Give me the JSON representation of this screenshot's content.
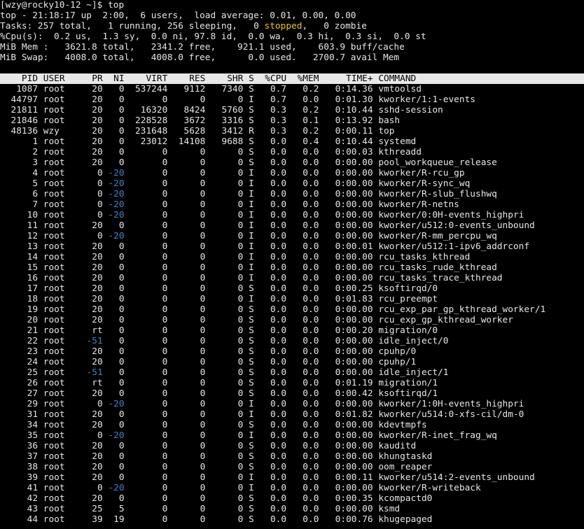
{
  "prompt": "[wzy@rocky10-12 ~]$ top",
  "summary": {
    "line1": "top - 21:18:17 up  2:00,  6 users,  load average: 0.01, 0.00, 0.00",
    "tasks_pre": "Tasks: 257 total,   1 running, 256 sleeping,   0 ",
    "tasks_hl": "stopped",
    "tasks_post": ",   0 zombie",
    "cpu": "%Cpu(s):  0.2 us,  1.3 sy,  0.0 ni, 97.8 id,  0.0 wa,  0.3 hi,  0.3 si,  0.0 st",
    "mem": "MiB Mem :   3621.8 total,   2341.2 free,    921.1 used,    603.9 buff/cache",
    "swap": "MiB Swap:   4008.0 total,   4008.0 free,      0.0 used.   2700.7 avail Mem"
  },
  "columns": [
    "PID",
    "USER",
    "PR",
    "NI",
    "VIRT",
    "RES",
    "SHR",
    "S",
    "%CPU",
    "%MEM",
    "TIME+",
    "COMMAND"
  ],
  "processes": [
    [
      "1087",
      "root",
      "20",
      "0",
      "537244",
      "9112",
      "7340",
      "S",
      "0.7",
      "0.2",
      "0:14.36",
      "vmtoolsd"
    ],
    [
      "44797",
      "root",
      "20",
      "0",
      "0",
      "0",
      "0",
      "I",
      "0.7",
      "0.0",
      "0:01.30",
      "kworker/1:1-events"
    ],
    [
      "21811",
      "root",
      "20",
      "0",
      "16320",
      "8424",
      "5760",
      "S",
      "0.3",
      "0.2",
      "0:10.44",
      "sshd-session"
    ],
    [
      "21846",
      "root",
      "20",
      "0",
      "228528",
      "3672",
      "3316",
      "S",
      "0.3",
      "0.1",
      "0:13.92",
      "bash"
    ],
    [
      "48136",
      "wzy",
      "20",
      "0",
      "231648",
      "5628",
      "3412",
      "R",
      "0.3",
      "0.2",
      "0:00.11",
      "top"
    ],
    [
      "1",
      "root",
      "20",
      "0",
      "23012",
      "14108",
      "9688",
      "S",
      "0.0",
      "0.4",
      "0:10.44",
      "systemd"
    ],
    [
      "2",
      "root",
      "20",
      "0",
      "0",
      "0",
      "0",
      "S",
      "0.0",
      "0.0",
      "0:00.03",
      "kthreadd"
    ],
    [
      "3",
      "root",
      "20",
      "0",
      "0",
      "0",
      "0",
      "S",
      "0.0",
      "0.0",
      "0:00.00",
      "pool_workqueue_release"
    ],
    [
      "4",
      "root",
      "0",
      "-20",
      "0",
      "0",
      "0",
      "I",
      "0.0",
      "0.0",
      "0:00.00",
      "kworker/R-rcu_gp"
    ],
    [
      "5",
      "root",
      "0",
      "-20",
      "0",
      "0",
      "0",
      "I",
      "0.0",
      "0.0",
      "0:00.00",
      "kworker/R-sync_wq"
    ],
    [
      "6",
      "root",
      "0",
      "-20",
      "0",
      "0",
      "0",
      "I",
      "0.0",
      "0.0",
      "0:00.00",
      "kworker/R-slub_flushwq"
    ],
    [
      "7",
      "root",
      "0",
      "-20",
      "0",
      "0",
      "0",
      "I",
      "0.0",
      "0.0",
      "0:00.00",
      "kworker/R-netns"
    ],
    [
      "10",
      "root",
      "0",
      "-20",
      "0",
      "0",
      "0",
      "I",
      "0.0",
      "0.0",
      "0:00.00",
      "kworker/0:0H-events_highpri"
    ],
    [
      "11",
      "root",
      "20",
      "0",
      "0",
      "0",
      "0",
      "I",
      "0.0",
      "0.0",
      "0:00.00",
      "kworker/u512:0-events_unbound"
    ],
    [
      "12",
      "root",
      "0",
      "-20",
      "0",
      "0",
      "0",
      "I",
      "0.0",
      "0.0",
      "0:00.00",
      "kworker/R-mm_percpu_wq"
    ],
    [
      "13",
      "root",
      "20",
      "0",
      "0",
      "0",
      "0",
      "I",
      "0.0",
      "0.0",
      "0:00.01",
      "kworker/u512:1-ipv6_addrconf"
    ],
    [
      "14",
      "root",
      "20",
      "0",
      "0",
      "0",
      "0",
      "I",
      "0.0",
      "0.0",
      "0:00.00",
      "rcu_tasks_kthread"
    ],
    [
      "15",
      "root",
      "20",
      "0",
      "0",
      "0",
      "0",
      "I",
      "0.0",
      "0.0",
      "0:00.00",
      "rcu_tasks_rude_kthread"
    ],
    [
      "16",
      "root",
      "20",
      "0",
      "0",
      "0",
      "0",
      "I",
      "0.0",
      "0.0",
      "0:00.00",
      "rcu_tasks_trace_kthread"
    ],
    [
      "17",
      "root",
      "20",
      "0",
      "0",
      "0",
      "0",
      "S",
      "0.0",
      "0.0",
      "0:00.25",
      "ksoftirqd/0"
    ],
    [
      "18",
      "root",
      "20",
      "0",
      "0",
      "0",
      "0",
      "I",
      "0.0",
      "0.0",
      "0:01.83",
      "rcu_preempt"
    ],
    [
      "19",
      "root",
      "20",
      "0",
      "0",
      "0",
      "0",
      "S",
      "0.0",
      "0.0",
      "0:00.00",
      "rcu_exp_par_gp_kthread_worker/1"
    ],
    [
      "20",
      "root",
      "20",
      "0",
      "0",
      "0",
      "0",
      "S",
      "0.0",
      "0.0",
      "0:00.00",
      "rcu_exp_gp_kthread_worker"
    ],
    [
      "21",
      "root",
      "rt",
      "0",
      "0",
      "0",
      "0",
      "S",
      "0.0",
      "0.0",
      "0:00.20",
      "migration/0"
    ],
    [
      "22",
      "root",
      "-51",
      "0",
      "0",
      "0",
      "0",
      "S",
      "0.0",
      "0.0",
      "0:00.00",
      "idle_inject/0"
    ],
    [
      "23",
      "root",
      "20",
      "0",
      "0",
      "0",
      "0",
      "S",
      "0.0",
      "0.0",
      "0:00.00",
      "cpuhp/0"
    ],
    [
      "24",
      "root",
      "20",
      "0",
      "0",
      "0",
      "0",
      "S",
      "0.0",
      "0.0",
      "0:00.00",
      "cpuhp/1"
    ],
    [
      "25",
      "root",
      "-51",
      "0",
      "0",
      "0",
      "0",
      "S",
      "0.0",
      "0.0",
      "0:00.00",
      "idle_inject/1"
    ],
    [
      "26",
      "root",
      "rt",
      "0",
      "0",
      "0",
      "0",
      "S",
      "0.0",
      "0.0",
      "0:01.19",
      "migration/1"
    ],
    [
      "27",
      "root",
      "20",
      "0",
      "0",
      "0",
      "0",
      "S",
      "0.0",
      "0.0",
      "0:00.42",
      "ksoftirqd/1"
    ],
    [
      "29",
      "root",
      "0",
      "-20",
      "0",
      "0",
      "0",
      "I",
      "0.0",
      "0.0",
      "0:00.00",
      "kworker/1:0H-events_highpri"
    ],
    [
      "31",
      "root",
      "20",
      "0",
      "0",
      "0",
      "0",
      "I",
      "0.0",
      "0.0",
      "0:01.82",
      "kworker/u514:0-xfs-cil/dm-0"
    ],
    [
      "34",
      "root",
      "20",
      "0",
      "0",
      "0",
      "0",
      "S",
      "0.0",
      "0.0",
      "0:00.00",
      "kdevtmpfs"
    ],
    [
      "35",
      "root",
      "0",
      "-20",
      "0",
      "0",
      "0",
      "I",
      "0.0",
      "0.0",
      "0:00.00",
      "kworker/R-inet_frag_wq"
    ],
    [
      "36",
      "root",
      "20",
      "0",
      "0",
      "0",
      "0",
      "S",
      "0.0",
      "0.0",
      "0:00.00",
      "kauditd"
    ],
    [
      "37",
      "root",
      "20",
      "0",
      "0",
      "0",
      "0",
      "S",
      "0.0",
      "0.0",
      "0:00.00",
      "khungtaskd"
    ],
    [
      "38",
      "root",
      "20",
      "0",
      "0",
      "0",
      "0",
      "S",
      "0.0",
      "0.0",
      "0:00.00",
      "oom_reaper"
    ],
    [
      "39",
      "root",
      "20",
      "0",
      "0",
      "0",
      "0",
      "I",
      "0.0",
      "0.0",
      "0:00.11",
      "kworker/u514:2-events_unbound"
    ],
    [
      "41",
      "root",
      "0",
      "-20",
      "0",
      "0",
      "0",
      "I",
      "0.0",
      "0.0",
      "0:00.00",
      "kworker/R-writeback"
    ],
    [
      "42",
      "root",
      "20",
      "0",
      "0",
      "0",
      "0",
      "S",
      "0.0",
      "0.0",
      "0:00.35",
      "kcompactd0"
    ],
    [
      "43",
      "root",
      "25",
      "5",
      "0",
      "0",
      "0",
      "S",
      "0.0",
      "0.0",
      "0:00.00",
      "ksmd"
    ],
    [
      "44",
      "root",
      "39",
      "19",
      "0",
      "0",
      "0",
      "S",
      "0.0",
      "0.0",
      "0:00.76",
      "khugepaged"
    ]
  ],
  "colors": {
    "background": "#000000",
    "foreground": "#e6e6e6",
    "header_bg": "#e8e8e8",
    "stopped_highlight": "#f0c800",
    "negative_pr": "#3a86c8"
  }
}
